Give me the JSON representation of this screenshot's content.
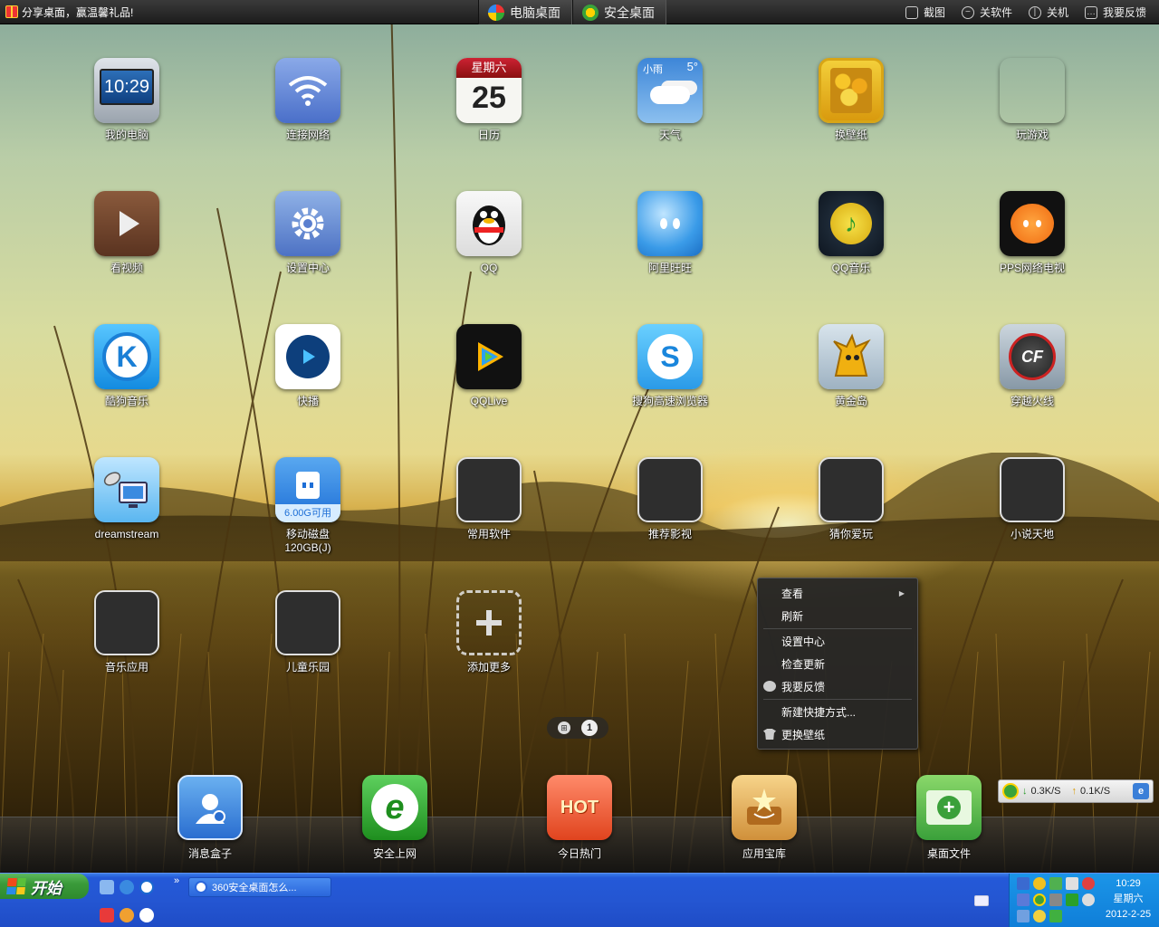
{
  "topbar": {
    "share_text": "分享桌面，赢温馨礼品!",
    "tabs": [
      {
        "label": "电脑桌面",
        "icon": "windows-icon"
      },
      {
        "label": "安全桌面",
        "icon": "shield-icon"
      }
    ],
    "actions": [
      {
        "label": "截图",
        "icon": "screenshot-icon"
      },
      {
        "label": "关软件",
        "icon": "minus-circle-icon"
      },
      {
        "label": "关机",
        "icon": "power-icon"
      },
      {
        "label": "我要反馈",
        "icon": "chat-icon"
      }
    ]
  },
  "apps": [
    {
      "label": "我的电脑",
      "icon": "monitor-clock-icon",
      "time": "10:29"
    },
    {
      "label": "连接网络",
      "icon": "wifi-icon"
    },
    {
      "label": "日历",
      "icon": "calendar-icon",
      "weekday": "星期六",
      "day": "25"
    },
    {
      "label": "天气",
      "icon": "weather-icon",
      "condition": "小雨",
      "temp": "5°"
    },
    {
      "label": "换壁纸",
      "icon": "sunflower-painting-icon"
    },
    {
      "label": "玩游戏",
      "icon": "games-icon"
    },
    {
      "label": "看视频",
      "icon": "film-play-icon"
    },
    {
      "label": "设置中心",
      "icon": "gear-icon"
    },
    {
      "label": "QQ",
      "icon": "qq-penguin-icon"
    },
    {
      "label": "阿里旺旺",
      "icon": "aliwangwang-icon"
    },
    {
      "label": "QQ音乐",
      "icon": "qq-music-icon"
    },
    {
      "label": "PPS网络电视",
      "icon": "pps-icon"
    },
    {
      "label": "酷狗音乐",
      "icon": "kugou-icon"
    },
    {
      "label": "快播",
      "icon": "qvod-icon"
    },
    {
      "label": "QQLive",
      "icon": "qqlive-icon"
    },
    {
      "label": "搜狗高速浏览器",
      "icon": "sogou-browser-icon"
    },
    {
      "label": "黄金岛",
      "icon": "golden-island-icon"
    },
    {
      "label": "穿越火线",
      "icon": "crossfire-icon"
    },
    {
      "label": "dreamstream",
      "icon": "satellite-pc-icon"
    },
    {
      "label": "移动磁盘\n120GB(J)",
      "icon": "usb-drive-icon",
      "badge": "6.00G可用"
    },
    {
      "label": "常用软件",
      "icon": "folder-icon"
    },
    {
      "label": "推荐影视",
      "icon": "folder-icon"
    },
    {
      "label": "猜你爱玩",
      "icon": "folder-icon"
    },
    {
      "label": "小说天地",
      "icon": "folder-icon"
    },
    {
      "label": "音乐应用",
      "icon": "folder-icon"
    },
    {
      "label": "儿童乐园",
      "icon": "folder-icon"
    },
    {
      "label": "添加更多",
      "icon": "add-icon"
    }
  ],
  "pager": {
    "current": "1"
  },
  "context_menu": [
    {
      "label": "查看",
      "submenu": true
    },
    {
      "label": "刷新"
    },
    {
      "sep": true
    },
    {
      "label": "设置中心"
    },
    {
      "label": "检查更新"
    },
    {
      "label": "我要反馈",
      "icon": "chat-icon"
    },
    {
      "sep": true
    },
    {
      "label": "新建快捷方式..."
    },
    {
      "label": "更换壁纸",
      "icon": "shirt-icon"
    }
  ],
  "dock": [
    {
      "label": "消息盒子",
      "icon": "message-box-icon"
    },
    {
      "label": "安全上网",
      "icon": "safe-ie-icon"
    },
    {
      "label": "今日热门",
      "icon": "hot-icon",
      "badge": "HOT"
    },
    {
      "label": "应用宝库",
      "icon": "app-treasure-icon"
    },
    {
      "label": "桌面文件",
      "icon": "desktop-files-icon"
    }
  ],
  "netspeed": {
    "down": "0.3K/S",
    "up": "0.1K/S",
    "down_arrow": "↓",
    "up_arrow": "↑"
  },
  "taskbar": {
    "start_label": "开始",
    "chevron": "»",
    "task_label": "360安全桌面怎么...",
    "clock_time": "10:29",
    "clock_weekday": "星期六",
    "clock_date": "2012-2-25"
  },
  "colors": {
    "topbar_bg": "#262626",
    "taskbar_bg": "#2456d2",
    "start_green": "#3a9a3a",
    "tray_bg": "#0f7ed8",
    "menu_bg": "#262626"
  }
}
